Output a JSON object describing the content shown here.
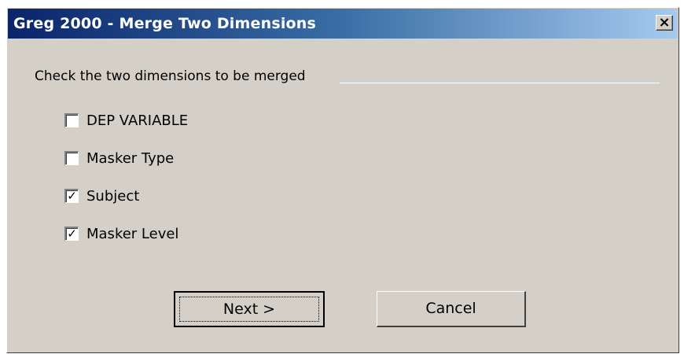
{
  "window": {
    "title": "Greg 2000 - Merge Two Dimensions",
    "close_glyph": "×",
    "close_icon": "close-icon"
  },
  "group": {
    "label": "Check the two dimensions to be merged"
  },
  "dimensions": [
    {
      "label": "DEP VARIABLE",
      "checked": false
    },
    {
      "label": "Masker Type",
      "checked": false
    },
    {
      "label": "Subject",
      "checked": true
    },
    {
      "label": "Masker Level",
      "checked": true
    }
  ],
  "check_glyph": "✓",
  "buttons": {
    "next_label": "Next >",
    "cancel_label": "Cancel"
  },
  "colors": {
    "titlebar_start": "#0a246a",
    "titlebar_end": "#a6caf0",
    "dialog_face": "#d4d0c8"
  }
}
